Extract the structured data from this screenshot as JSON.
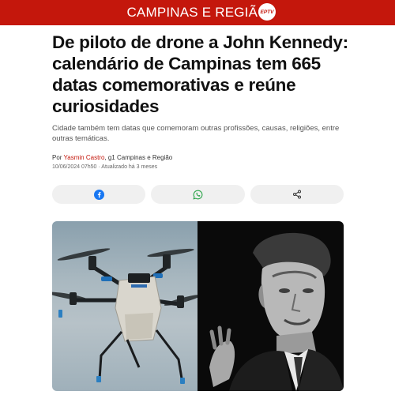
{
  "header": {
    "section": "CAMPINAS E REGIÃO",
    "logo_text": "EPTV"
  },
  "article": {
    "headline": "De piloto de drone a John Kennedy: calendário de Campinas tem 665 datas comemorativas e reúne curiosidades",
    "subtitle": "Cidade também tem datas que comemoram outras profissões, causas, religiões, entre outras temáticas.",
    "byline_prefix": "Por ",
    "author": "Yasmin Castro",
    "byline_suffix": ", g1 Campinas e Região",
    "date": "10/06/2024 07h50 · Atualizado há 3 meses"
  },
  "share": {
    "buttons": [
      {
        "icon": "facebook-icon"
      },
      {
        "icon": "whatsapp-icon"
      },
      {
        "icon": "share-icon"
      }
    ]
  },
  "image": {
    "left": "agricultural-drone-photo",
    "right": "john-kennedy-photo"
  },
  "colors": {
    "brand_red": "#c4170c",
    "facebook_blue": "#1877f2",
    "whatsapp_green": "#25a244"
  }
}
